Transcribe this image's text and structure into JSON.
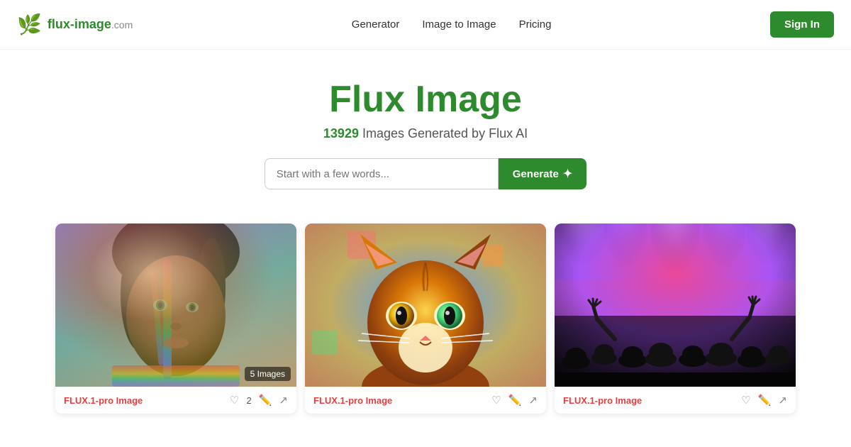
{
  "logo": {
    "brand": "flux-image",
    "tld": ".com",
    "icon": "🌿"
  },
  "nav": {
    "items": [
      {
        "label": "Generator",
        "href": "#"
      },
      {
        "label": "Image to Image",
        "href": "#"
      },
      {
        "label": "Pricing",
        "href": "#"
      }
    ],
    "signin_label": "Sign In"
  },
  "hero": {
    "title": "Flux Image",
    "count": "13929",
    "subtitle_text": " Images Generated by Flux AI",
    "search_placeholder": "Start with a few words...",
    "generate_label": "Generate"
  },
  "gallery": {
    "badge": "5 Images",
    "items": [
      {
        "title": "FLUX.1-pro Image",
        "likes": "2",
        "type": "woman-rainbow"
      },
      {
        "title": "FLUX.1-pro Image",
        "likes": "",
        "type": "cat"
      },
      {
        "title": "FLUX.1-pro Image",
        "likes": "",
        "type": "concert"
      }
    ]
  }
}
